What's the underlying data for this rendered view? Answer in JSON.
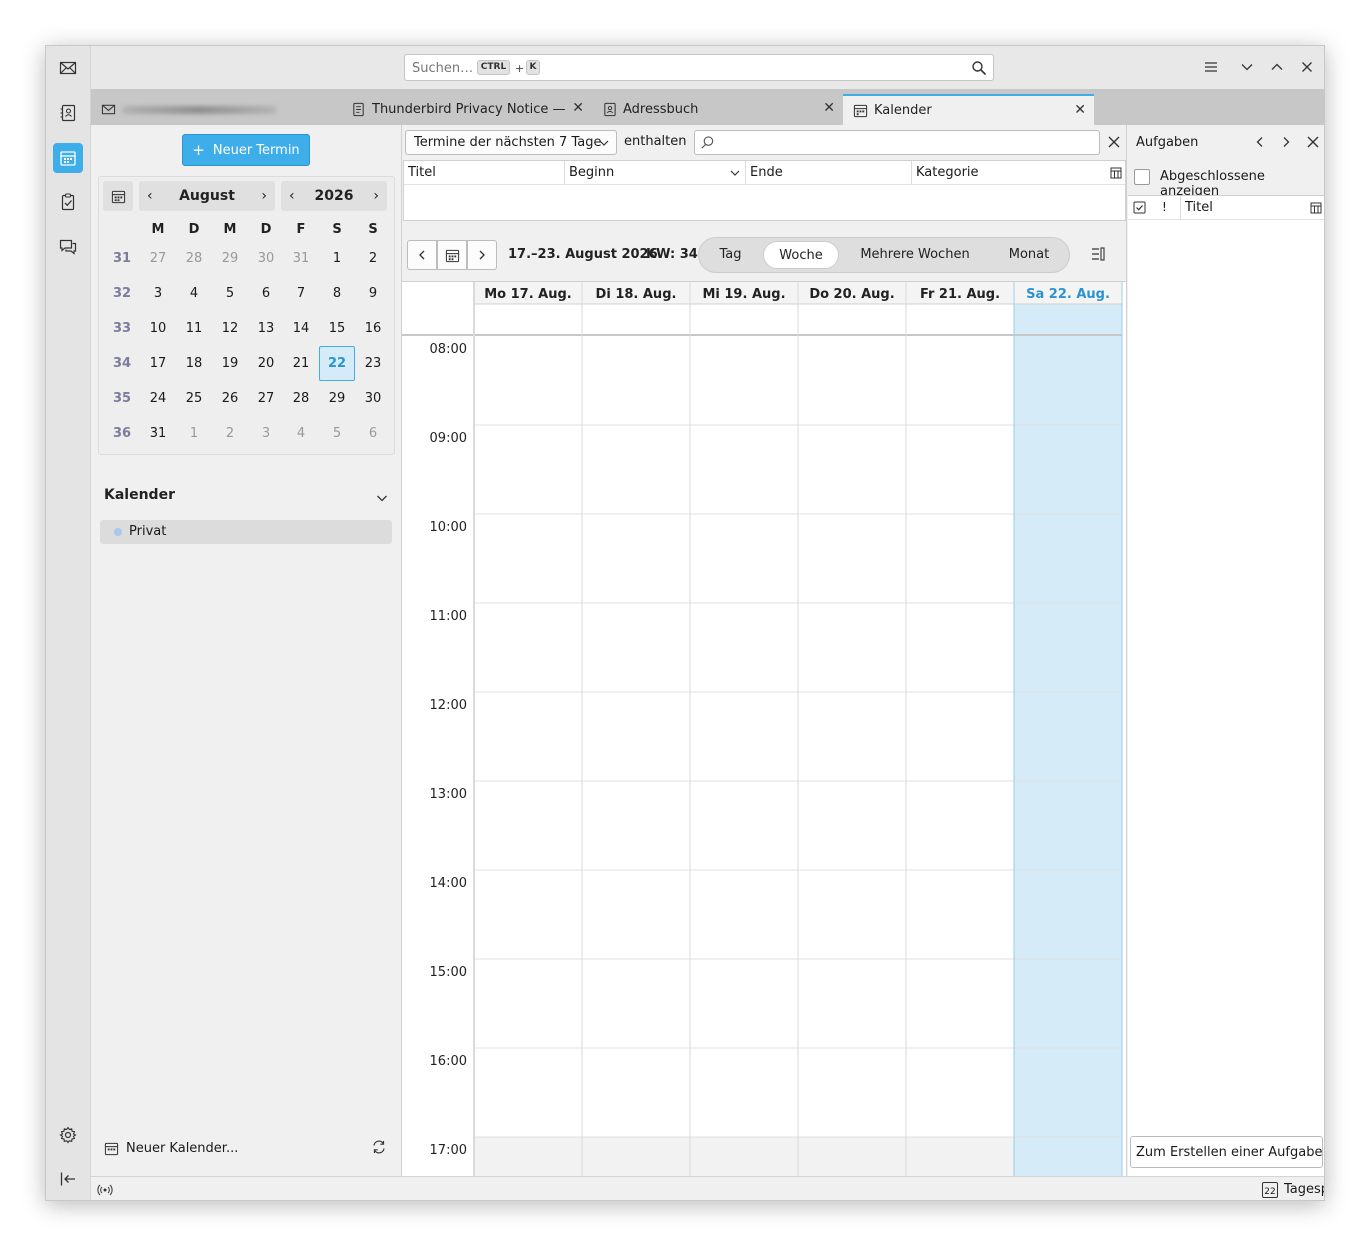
{
  "search": {
    "placeholder": "Suchen…",
    "key_ctrl": "CTRL",
    "key_plus": "+",
    "key_k": "K"
  },
  "spaces": [
    "mail-icon",
    "address-book-icon",
    "calendar-icon",
    "tasks-icon",
    "chat-icon",
    "settings-icon",
    "collapse-icon"
  ],
  "tabs": [
    {
      "label": "",
      "icon": "mail-icon",
      "blurred": true
    },
    {
      "label": "Thunderbird Privacy Notice —",
      "icon": "document-icon"
    },
    {
      "label": "Adressbuch",
      "icon": "address-book-icon"
    },
    {
      "label": "Kalender",
      "icon": "calendar-icon",
      "active": true
    }
  ],
  "left": {
    "new_event": "Neuer Termin",
    "new_event_icon": "+",
    "month": "August",
    "year": "2026",
    "weekday_headers": [
      "M",
      "D",
      "M",
      "D",
      "F",
      "S",
      "S"
    ],
    "weeks": [
      {
        "kw": "31",
        "days": [
          "27",
          "28",
          "29",
          "30",
          "31",
          "1",
          "2"
        ],
        "out": [
          0,
          1,
          2,
          3,
          4
        ]
      },
      {
        "kw": "32",
        "days": [
          "3",
          "4",
          "5",
          "6",
          "7",
          "8",
          "9"
        ],
        "out": []
      },
      {
        "kw": "33",
        "days": [
          "10",
          "11",
          "12",
          "13",
          "14",
          "15",
          "16"
        ],
        "out": []
      },
      {
        "kw": "34",
        "days": [
          "17",
          "18",
          "19",
          "20",
          "21",
          "22",
          "23"
        ],
        "out": [],
        "today": 5
      },
      {
        "kw": "35",
        "days": [
          "24",
          "25",
          "26",
          "27",
          "28",
          "29",
          "30"
        ],
        "out": []
      },
      {
        "kw": "36",
        "days": [
          "31",
          "1",
          "2",
          "3",
          "4",
          "5",
          "6"
        ],
        "out": [
          1,
          2,
          3,
          4,
          5,
          6
        ]
      }
    ],
    "calendars_title": "Kalender",
    "calendars": [
      {
        "name": "Privat",
        "color": "#a8c8ec"
      }
    ],
    "new_calendar": "Neuer Kalender..."
  },
  "filter": {
    "select": "Termine der nächsten 7 Tage",
    "contains": "enthalten",
    "columns": [
      "Titel",
      "Beginn",
      "Ende",
      "Kategorie"
    ]
  },
  "nav": {
    "range": "17.–23. August 2026",
    "week_number": "KW: 34",
    "views": [
      "Tag",
      "Woche",
      "Mehrere Wochen",
      "Monat"
    ],
    "active_view": "Woche"
  },
  "week": {
    "days": [
      "Mo 17. Aug.",
      "Di 18. Aug.",
      "Mi 19. Aug.",
      "Do 20. Aug.",
      "Fr 21. Aug.",
      "Sa 22. Aug."
    ],
    "today_index": 5,
    "hours": [
      "08:00",
      "09:00",
      "10:00",
      "11:00",
      "12:00",
      "13:00",
      "14:00",
      "15:00",
      "16:00",
      "17:00"
    ]
  },
  "tasks": {
    "title": "Aufgaben",
    "show_completed": "Abgeschlossene anzeigen",
    "col_priority": "!",
    "col_title": "Titel",
    "new_task_placeholder": "Zum Erstellen einer Aufgabe h"
  },
  "status": {
    "day_plan": "Tagesplan",
    "day_plan_number": "22"
  },
  "colors": {
    "accent": "#3daee9",
    "today_bg": "#d5ebf8",
    "today_text": "#2a94cf"
  }
}
